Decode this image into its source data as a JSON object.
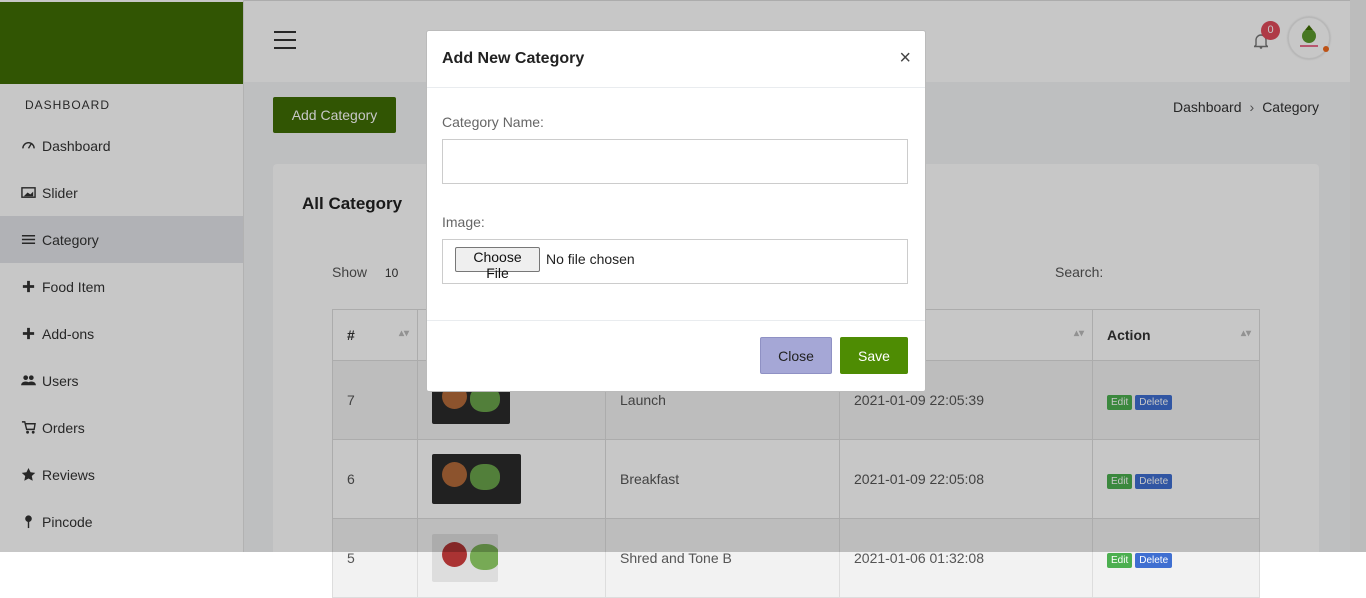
{
  "sidebar": {
    "section_title": "DASHBOARD",
    "items": [
      {
        "label": "Dashboard",
        "icon": "dashboard-icon"
      },
      {
        "label": "Slider",
        "icon": "image-icon"
      },
      {
        "label": "Category",
        "icon": "list-icon"
      },
      {
        "label": "Food Item",
        "icon": "plus-icon"
      },
      {
        "label": "Add-ons",
        "icon": "plus-icon"
      },
      {
        "label": "Users",
        "icon": "users-icon"
      },
      {
        "label": "Orders",
        "icon": "cart-icon"
      },
      {
        "label": "Reviews",
        "icon": "star-icon"
      },
      {
        "label": "Pincode",
        "icon": "pin-icon"
      }
    ],
    "active": "Category"
  },
  "topbar": {
    "notification_count": "0"
  },
  "page": {
    "add_button": "Add Category",
    "breadcrumb": [
      "Dashboard",
      "Category"
    ],
    "card_title": "All Category",
    "show_label": "Show",
    "show_value": "10",
    "search_label": "Search:"
  },
  "table": {
    "headers": [
      "#",
      "",
      "",
      "",
      "Action"
    ],
    "rows": [
      {
        "id": "7",
        "name": "Launch",
        "date": "2021-01-09 22:05:39"
      },
      {
        "id": "6",
        "name": "Breakfast",
        "date": "2021-01-09 22:05:08"
      },
      {
        "id": "5",
        "name": "Shred and Tone B",
        "date": "2021-01-06 01:32:08"
      }
    ],
    "edit_label": "Edit",
    "delete_label": "Delete"
  },
  "modal": {
    "title": "Add New Category",
    "close_symbol": "×",
    "category_name_label": "Category Name:",
    "category_name_value": "",
    "image_label": "Image:",
    "file_button": "Choose File",
    "file_status": "No file chosen",
    "close_button": "Close",
    "save_button": "Save"
  },
  "colors": {
    "brand": "#3f6e04",
    "save": "#4e8c03",
    "close": "#a5a7d6",
    "badge": "#e04b5a"
  }
}
